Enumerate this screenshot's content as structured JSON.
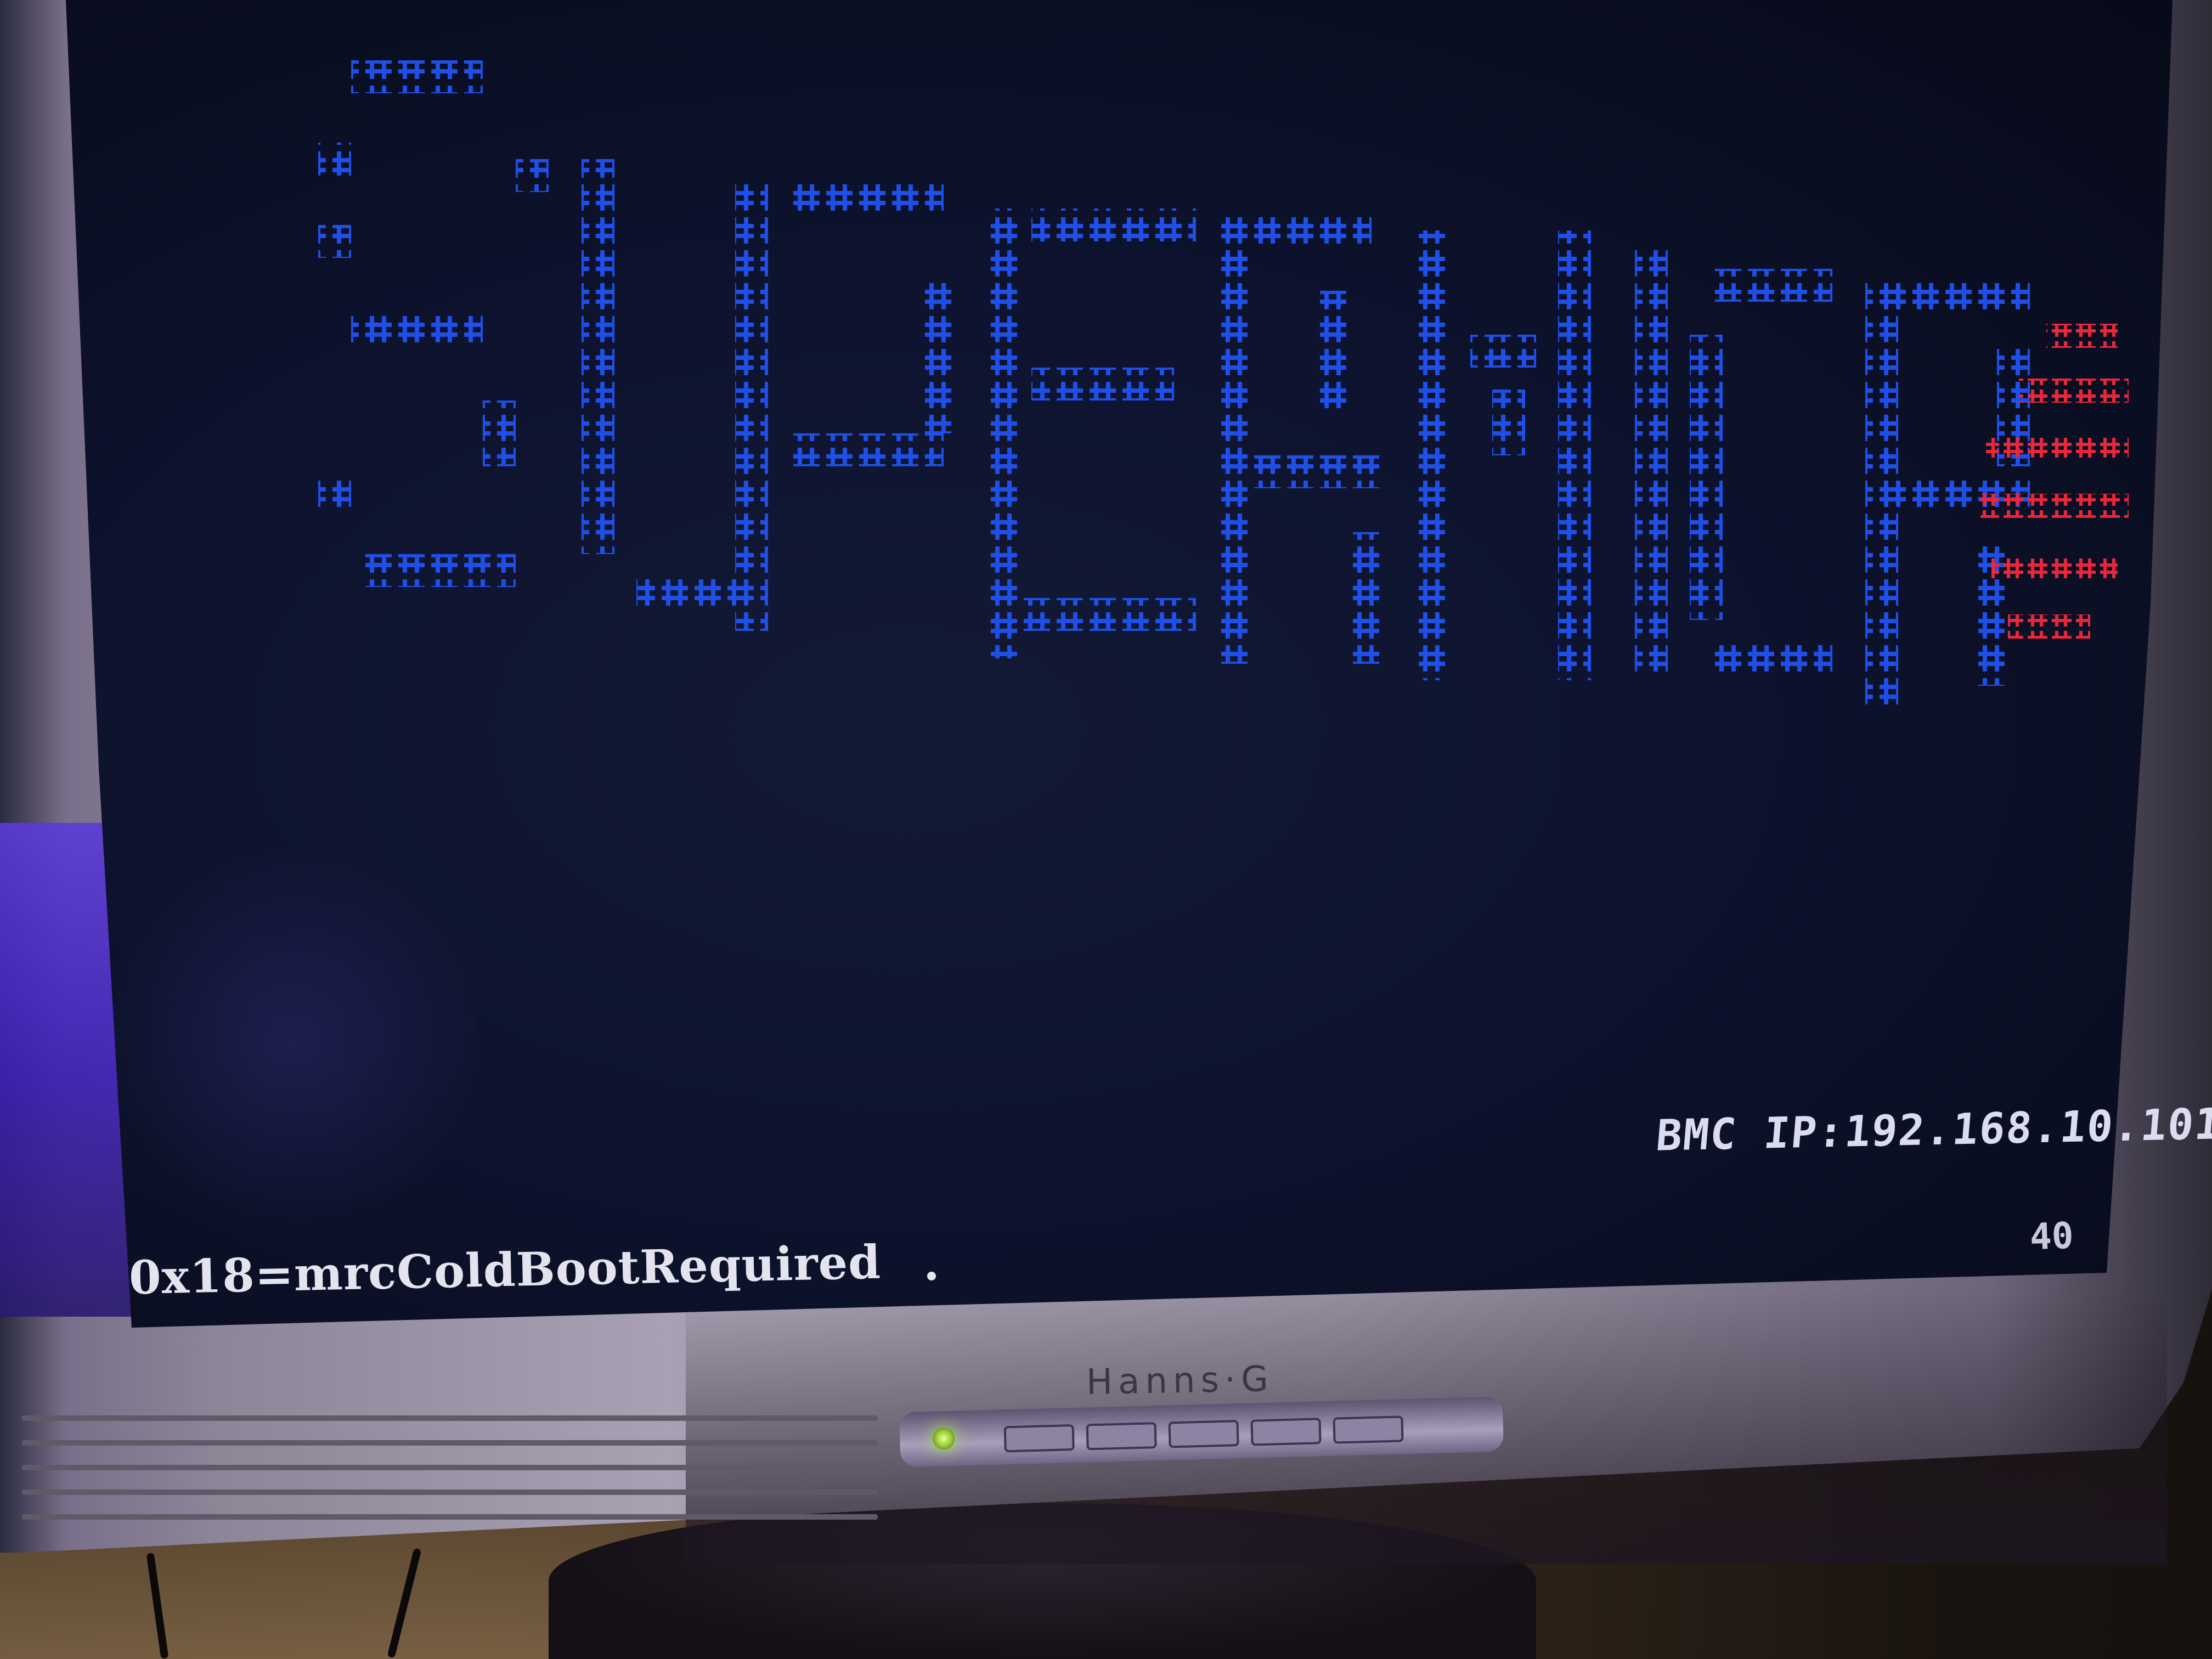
{
  "screen": {
    "bmc_ip": "BMC IP:192.168.10.101",
    "post_code": "40",
    "status_message": "0x18=mrcColdBootRequired",
    "logo_colors": {
      "letters": "#1f4fe6",
      "accent": "#e8283a"
    }
  },
  "monitor": {
    "brand": "Hanns·G"
  }
}
